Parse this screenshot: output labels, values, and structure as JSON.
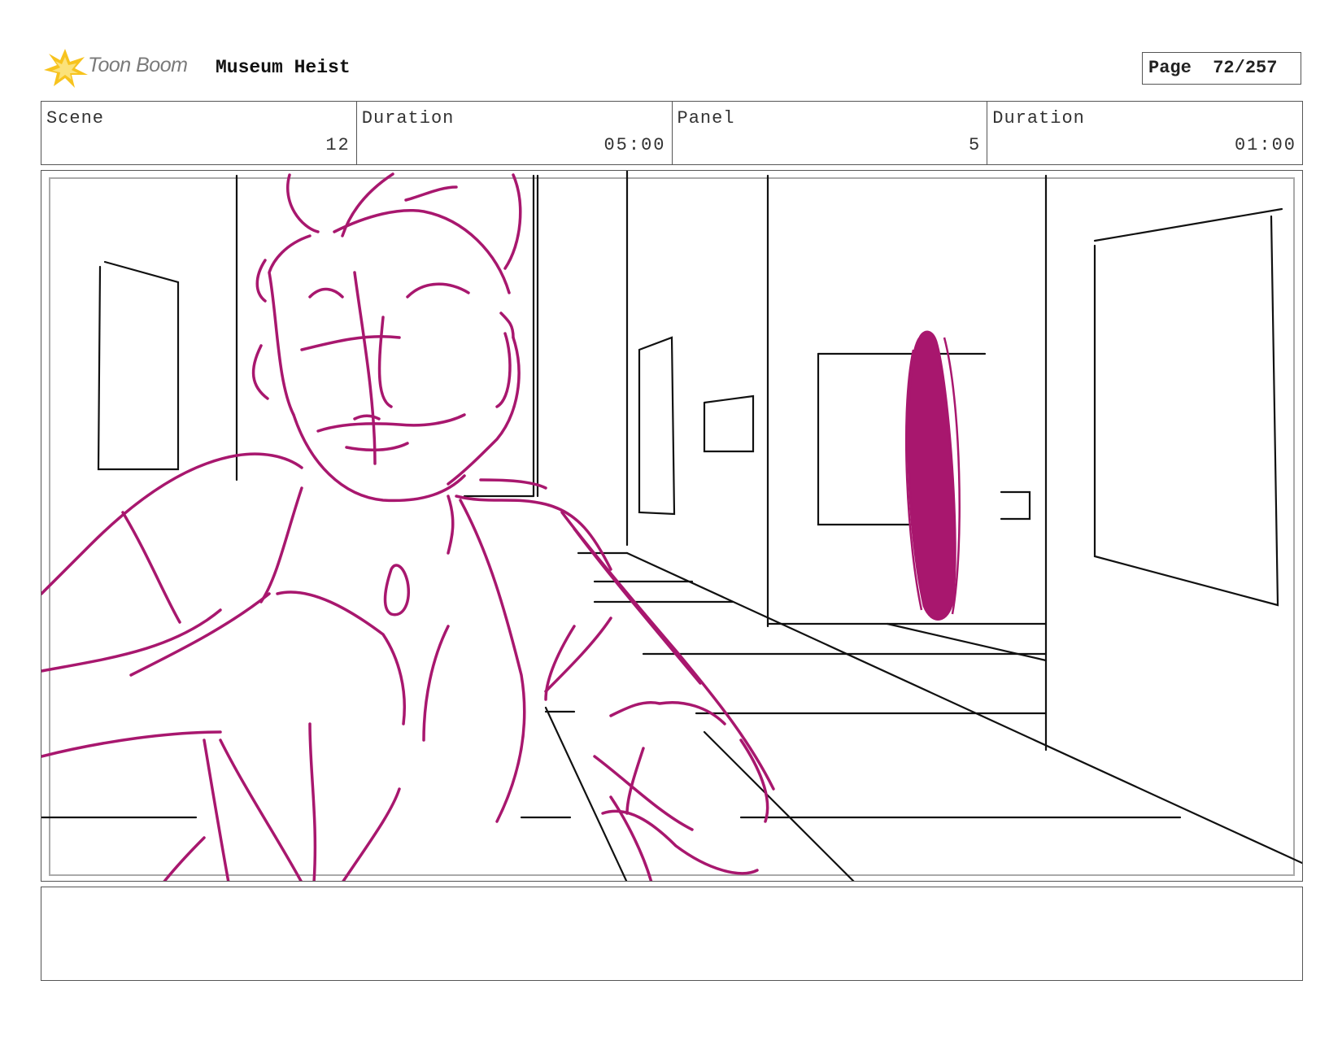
{
  "header": {
    "logo_text": "Toon Boom",
    "logo_icon": "starburst-icon",
    "project_title": "Museum Heist",
    "page_label": "Page",
    "page_value": "72/257"
  },
  "info": [
    {
      "label": "Scene",
      "value": "12"
    },
    {
      "label": "Duration",
      "value": "05:00"
    },
    {
      "label": "Panel",
      "value": "5"
    },
    {
      "label": "Duration",
      "value": "01:00"
    }
  ],
  "notes": "",
  "colors": {
    "sketch": "#a8176e",
    "background_lines": "#111111",
    "border": "#555555"
  }
}
